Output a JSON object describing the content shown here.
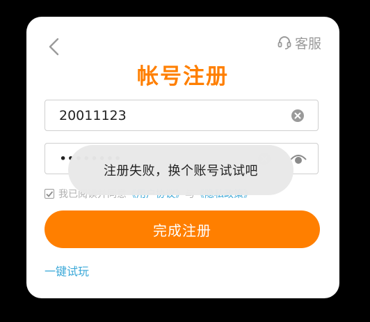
{
  "header": {
    "back_icon": "chevron-left-icon",
    "support_label": "客服",
    "support_icon": "headset-icon",
    "title": "帐号注册"
  },
  "form": {
    "account_value": "20011123",
    "password_value": "••••••••",
    "clear_icon": "clear-circle-icon",
    "eye_icon": "eye-icon"
  },
  "agreement": {
    "prefix": "我已阅读并同意",
    "user_agreement": "《用户协议》",
    "joiner": "与",
    "privacy_policy": "《隐私政策》",
    "checked": true
  },
  "actions": {
    "submit_label": "完成注册",
    "trial_label": "一键试玩"
  },
  "toast": {
    "message": "注册失败，换个账号试试吧"
  },
  "colors": {
    "accent": "#ff7f00",
    "link": "#3aa8d8",
    "muted": "#9a9a9a"
  }
}
